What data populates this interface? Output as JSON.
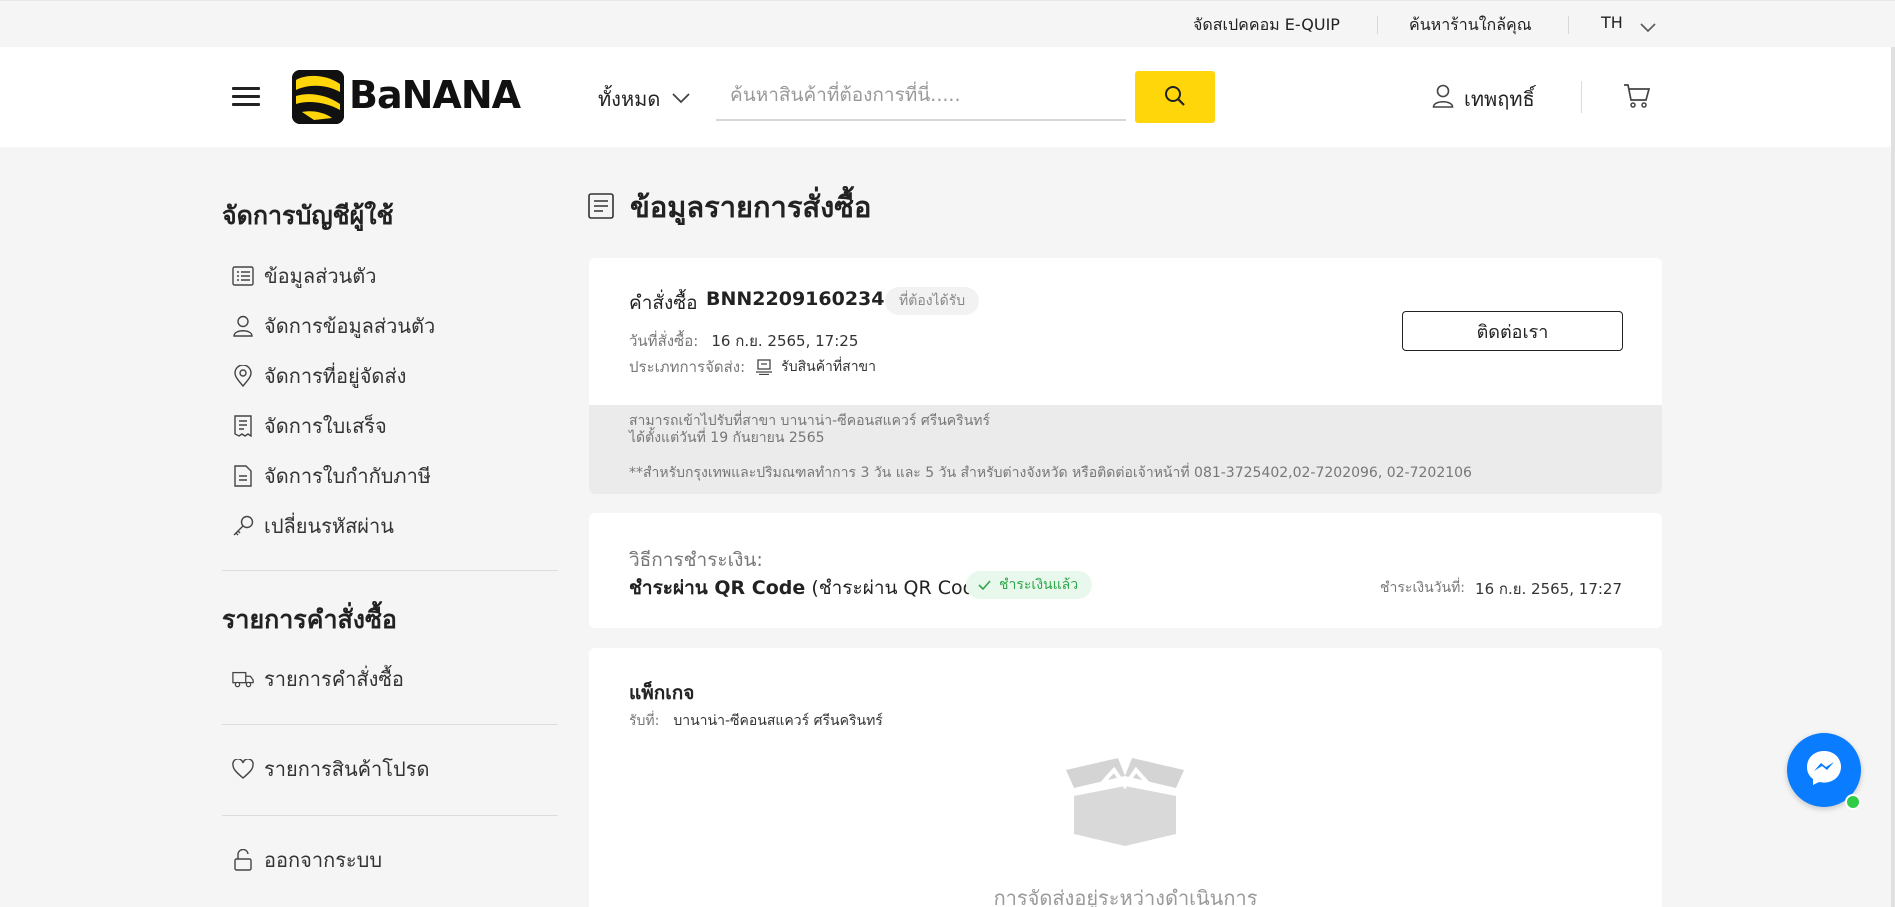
{
  "topbar": {
    "equip_link": "จัดสเปคคอม E-QUIP",
    "store_link": "ค้นหาร้านใกล้คุณ",
    "language": "TH"
  },
  "header": {
    "logo_text": "BaNANA",
    "category": "ทั้งหมด",
    "search_placeholder": "ค้นหาสินค้าที่ต้องการที่นี่.....",
    "user_name": "เทพฤทธิ์",
    "accent_color": "#ffd60a"
  },
  "sidebar": {
    "account_title": "จัดการบัญชีผู้ใช้",
    "account_items": [
      {
        "label": "ข้อมูลส่วนตัว",
        "icon": "list-icon"
      },
      {
        "label": "จัดการข้อมูลส่วนตัว",
        "icon": "user-icon"
      },
      {
        "label": "จัดการที่อยู่จัดส่ง",
        "icon": "location-pin-icon"
      },
      {
        "label": "จัดการใบเสร็จ",
        "icon": "receipt-icon"
      },
      {
        "label": "จัดการใบกำกับภาษี",
        "icon": "document-icon"
      },
      {
        "label": "เปลี่ยนรหัสผ่าน",
        "icon": "key-icon"
      }
    ],
    "orders_title": "รายการคำสั่งซื้อ",
    "orders_item": "รายการคำสั่งซื้อ",
    "wishlist_item": "รายการสินค้าโปรด",
    "logout_item": "ออกจากระบบ"
  },
  "page": {
    "title": "ข้อมูลรายการสั่งซื้อ"
  },
  "order": {
    "order_label": "คำสั่งซื้อ",
    "order_number": "BNN2209160234",
    "status_badge": "ที่ต้องได้รับ",
    "date_label": "วันที่สั่งซื้อ:",
    "date_value": "16 ก.ย. 2565, 17:25",
    "ship_label": "ประเภทการจัดส่ง:",
    "ship_value": "รับสินค้าที่สาขา",
    "contact_button": "ติดต่อเรา",
    "notice_line1": "สามารถเข้าไปรับที่สาขา บานาน่า-ซีคอนสแควร์ ศรีนครินทร์",
    "notice_line2": "ได้ตั้งแต่วันที่ 19 กันยายน 2565",
    "notice_line3": "**สำหรับกรุงเทพและปริมณฑลทำการ 3 วัน และ 5 วัน สำหรับต่างจังหวัด หรือติดต่อเจ้าหน้าที่ 081-3725402,02-7202096, 02-7202106"
  },
  "payment": {
    "label": "วิธีการชำระเงิน:",
    "method_bold": "ชำระผ่าน QR Code",
    "method_extra": "(ชำระผ่าน QR Code)",
    "status_badge": "ชำระเงินแล้ว",
    "paid_label": "ชำระเงินวันที่:",
    "paid_value": "16 ก.ย. 2565, 17:27",
    "success_color": "#2ea84a"
  },
  "package": {
    "title": "แพ็กเกจ",
    "pickup_label": "รับที่:",
    "pickup_value": "บานาน่า-ซีคอนสแควร์ ศรีนครินทร์",
    "status_text": "การจัดส่งอยู่ระหว่างดำเนินการ"
  },
  "chat": {
    "brand_color": "#0a7cff"
  }
}
